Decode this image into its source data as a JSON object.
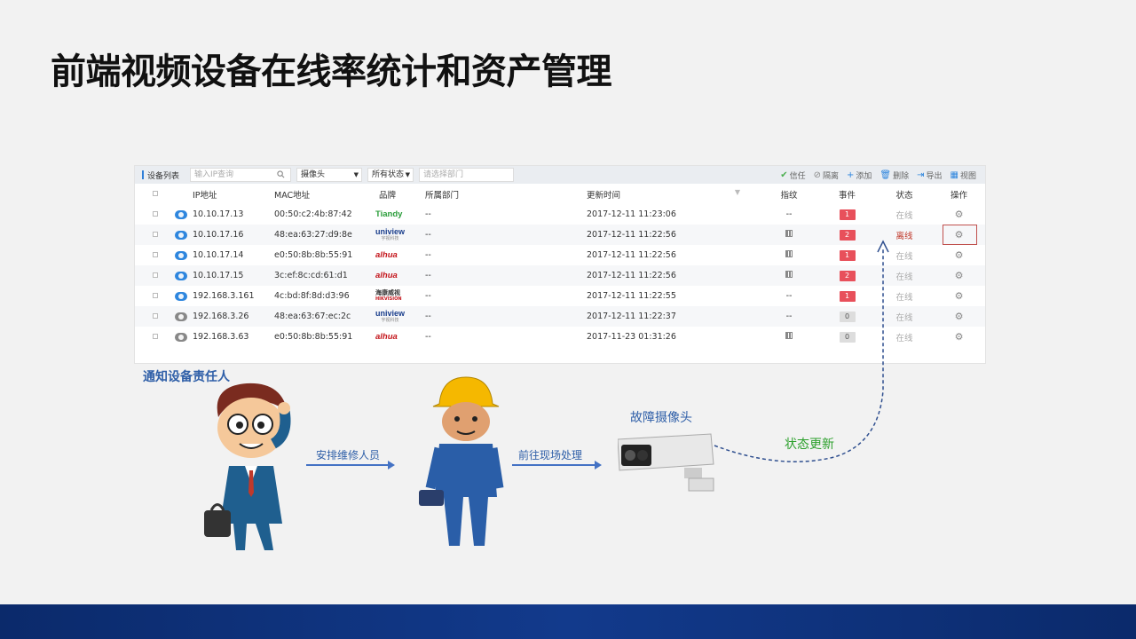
{
  "page": {
    "title": "前端视频设备在线率统计和资产管理"
  },
  "toolbar": {
    "title": "设备列表",
    "search_placeholder": "输入IP查询",
    "type_select": "摄像头",
    "status_select": "所有状态",
    "dept_placeholder": "请选择部门",
    "actions": [
      {
        "icon": "check-icon",
        "glyph": "✔",
        "label": "信任",
        "color": "#4caf50"
      },
      {
        "icon": "ban-icon",
        "glyph": "⊘",
        "label": "隔离",
        "color": "#888"
      },
      {
        "icon": "plus-icon",
        "glyph": "+",
        "label": "添加",
        "color": "#2e86de"
      },
      {
        "icon": "trash-icon",
        "glyph": "🗑",
        "label": "删除",
        "color": "#2e86de"
      },
      {
        "icon": "export-icon",
        "glyph": "⇥",
        "label": "导出",
        "color": "#2e86de"
      },
      {
        "icon": "grid-icon",
        "glyph": "▦",
        "label": "视图",
        "color": "#2e86de"
      }
    ]
  },
  "table": {
    "headers": {
      "ip": "IP地址",
      "mac": "MAC地址",
      "brand": "品牌",
      "dept": "所属部门",
      "time": "更新时间",
      "fingerprint": "指纹",
      "event": "事件",
      "status": "状态",
      "op": "操作"
    },
    "rows": [
      {
        "online": true,
        "ip": "10.10.17.13",
        "mac": "00:50:c2:4b:87:42",
        "brand": "Tiandy",
        "dept": "--",
        "time": "2017-12-11 11:23:06",
        "fp": "--",
        "event": "1",
        "event_color": "red",
        "status": "在线"
      },
      {
        "online": true,
        "ip": "10.10.17.16",
        "mac": "48:ea:63:27:d9:8e",
        "brand": "uniview",
        "dept": "--",
        "time": "2017-12-11 11:22:56",
        "fp": "icon",
        "event": "2",
        "event_color": "red",
        "status": "离线"
      },
      {
        "online": true,
        "ip": "10.10.17.14",
        "mac": "e0:50:8b:8b:55:91",
        "brand": "alhua",
        "dept": "--",
        "time": "2017-12-11 11:22:56",
        "fp": "icon",
        "event": "1",
        "event_color": "red",
        "status": "在线"
      },
      {
        "online": true,
        "ip": "10.10.17.15",
        "mac": "3c:ef:8c:cd:61:d1",
        "brand": "alhua",
        "dept": "--",
        "time": "2017-12-11 11:22:56",
        "fp": "icon",
        "event": "2",
        "event_color": "red",
        "status": "在线"
      },
      {
        "online": true,
        "ip": "192.168.3.161",
        "mac": "4c:bd:8f:8d:d3:96",
        "brand": "hikvision",
        "dept": "--",
        "time": "2017-12-11 11:22:55",
        "fp": "--",
        "event": "1",
        "event_color": "red",
        "status": "在线"
      },
      {
        "online": false,
        "ip": "192.168.3.26",
        "mac": "48:ea:63:67:ec:2c",
        "brand": "uniview",
        "dept": "--",
        "time": "2017-12-11 11:22:37",
        "fp": "--",
        "event": "0",
        "event_color": "gray",
        "status": "在线"
      },
      {
        "online": false,
        "ip": "192.168.3.63",
        "mac": "e0:50:8b:8b:55:91",
        "brand": "alhua",
        "dept": "--",
        "time": "2017-11-23 01:31:26",
        "fp": "icon",
        "event": "0",
        "event_color": "gray",
        "status": "在线"
      }
    ]
  },
  "brands": {
    "Tiandy": {
      "text": "Tiandy"
    },
    "uniview": {
      "text": "uniview",
      "sub": "宇视科技"
    },
    "alhua": {
      "text": "alhua"
    },
    "hikvision": {
      "text": "海康威视",
      "sub": "HIKVISION"
    }
  },
  "flow": {
    "notice": "通知设备责任人",
    "step1": "安排维修人员",
    "step2": "前往现场处理",
    "camera": "故障摄像头",
    "status": "状态更新"
  }
}
